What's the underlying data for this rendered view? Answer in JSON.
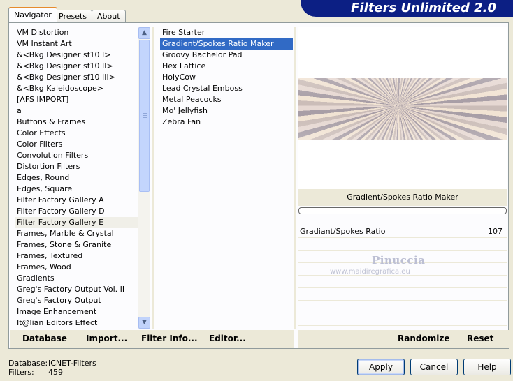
{
  "app": {
    "title": "Filters Unlimited 2.0"
  },
  "tabs": [
    {
      "label": "Navigator",
      "active": true
    },
    {
      "label": "Presets",
      "active": false
    },
    {
      "label": "About",
      "active": false
    }
  ],
  "categories": [
    "VM Distortion",
    "VM Instant Art",
    "&<Bkg Designer sf10 I>",
    "&<Bkg Designer sf10 II>",
    "&<Bkg Designer sf10 III>",
    "&<Bkg Kaleidoscope>",
    "[AFS IMPORT]",
    "a",
    "Buttons & Frames",
    "Color Effects",
    "Color Filters",
    "Convolution Filters",
    "Distortion Filters",
    "Edges, Round",
    "Edges, Square",
    "Filter Factory Gallery A",
    "Filter Factory Gallery D",
    "Filter Factory Gallery E",
    "Frames, Marble & Crystal",
    "Frames, Stone & Granite",
    "Frames, Textured",
    "Frames, Wood",
    "Gradients",
    "Greg's Factory Output Vol. II",
    "Greg's Factory Output",
    "Image Enhancement",
    "It@lian Editors Effect"
  ],
  "selected_category": "Filter Factory Gallery E",
  "filters": [
    "Fire Starter",
    "Gradient/Spokes Ratio Maker",
    "Groovy Bachelor Pad",
    "Hex Lattice",
    "HolyCow",
    "Lead Crystal Emboss",
    "Metal Peacocks",
    "Mo' Jellyfish",
    "Zebra Fan"
  ],
  "selected_filter": "Gradient/Spokes Ratio Maker",
  "preview": {
    "filter_name": "Gradient/Spokes Ratio Maker"
  },
  "params": [
    {
      "label": "Gradiant/Spokes Ratio",
      "value": "107"
    }
  ],
  "watermark": {
    "name": "Pinuccia",
    "url": "www.maidiregrafica.eu"
  },
  "toolbar": {
    "database": "Database",
    "import": "Import...",
    "filter_info": "Filter Info...",
    "editor": "Editor...",
    "randomize": "Randomize",
    "reset": "Reset"
  },
  "status": {
    "database_label": "Database:",
    "database_value": "ICNET-Filters",
    "filters_label": "Filters:",
    "filters_value": "459"
  },
  "buttons": {
    "apply": "Apply",
    "cancel": "Cancel",
    "help": "Help"
  }
}
